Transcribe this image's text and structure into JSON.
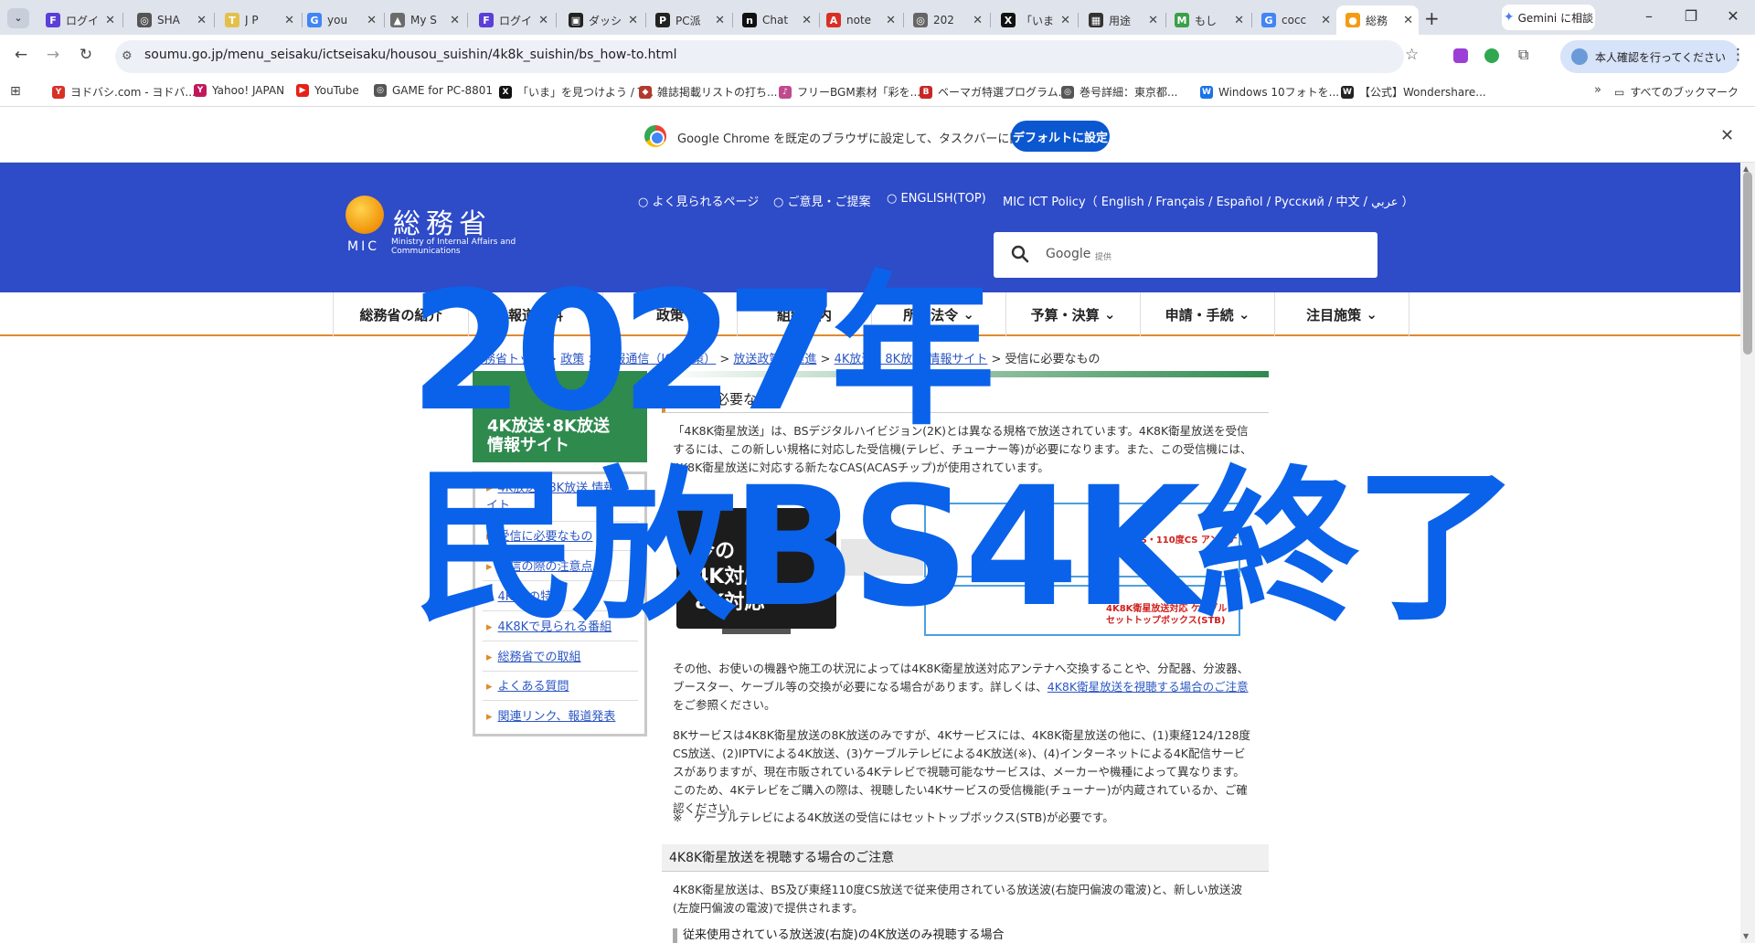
{
  "tabs": [
    {
      "label": "ログイ",
      "fav": "F",
      "color": "#5b3fd6"
    },
    {
      "label": "SHA",
      "fav": "◎",
      "color": "#555555"
    },
    {
      "label": "J P",
      "fav": "T",
      "color": "#e3c04a"
    },
    {
      "label": "you",
      "fav": "G",
      "color": "#4285f4"
    },
    {
      "label": "My S",
      "fav": "▲",
      "color": "#6b6b6b"
    },
    {
      "label": "ログイ",
      "fav": "F",
      "color": "#5b3fd6"
    },
    {
      "label": "ダッシ",
      "fav": "▣",
      "color": "#222222"
    },
    {
      "label": "PC派",
      "fav": "P",
      "color": "#222222"
    },
    {
      "label": "Chat",
      "fav": "n",
      "color": "#111111"
    },
    {
      "label": "note",
      "fav": "A",
      "color": "#d93025"
    },
    {
      "label": "202",
      "fav": "◎",
      "color": "#666666"
    },
    {
      "label": "「いま",
      "fav": "X",
      "color": "#111111"
    },
    {
      "label": "用途",
      "fav": "▦",
      "color": "#333333"
    },
    {
      "label": "もし",
      "fav": "M",
      "color": "#3aa04a"
    },
    {
      "label": "cocc",
      "fav": "G",
      "color": "#4285f4"
    },
    {
      "label": "総務",
      "fav": "●",
      "color": "#f39c12"
    }
  ],
  "gemini_label": "Gemini に相談",
  "url": "soumu.go.jp/menu_seisaku/ictseisaku/housou_suishin/4k8k_suishin/bs_how-to.html",
  "profile_label": "本人確認を行ってください",
  "bookmarks": [
    {
      "label": "ヨドバシ.com - ヨドバ...",
      "color": "#d93025",
      "fav": "Y"
    },
    {
      "label": "Yahoo! JAPAN",
      "color": "#c2185b",
      "fav": "Y"
    },
    {
      "label": "YouTube",
      "color": "#e62117",
      "fav": "▶"
    },
    {
      "label": "GAME for PC-8801",
      "color": "#555555",
      "fav": "◎"
    },
    {
      "label": "「いま」を見つけよう / T...",
      "color": "#111111",
      "fav": "X"
    },
    {
      "label": "雑誌掲載リストの打ち...",
      "color": "#b23a2c",
      "fav": "◆"
    },
    {
      "label": "フリーBGM素材「彩を...",
      "color": "#c04a8e",
      "fav": "♪"
    },
    {
      "label": "ベーマガ特選プログラム...",
      "color": "#c62828",
      "fav": "B"
    },
    {
      "label": "巻号詳細：東京都...",
      "color": "#555555",
      "fav": "◎"
    },
    {
      "label": "Windows 10フォトを...",
      "color": "#1a73e8",
      "fav": "W"
    },
    {
      "label": "【公式】Wondershare...",
      "color": "#222222",
      "fav": "W"
    }
  ],
  "all_bookmarks_label": "すべてのブックマーク",
  "infobar": {
    "text": "Google Chrome を既定のブラウザに設定して、タスクバーに固定する",
    "button": "デフォルトに設定"
  },
  "site": {
    "logo_kanji": "総務省",
    "logo_abbr": "MIC",
    "logo_english": "Ministry of Internal Affairs and Communications",
    "header_links": [
      "○ よく見られるページ",
      "○ ご意見・ご提案",
      "○ ENGLISH(TOP)",
      "MIC ICT Policy（ English /  Français /  Español /  Русский /  中文 /  عربي ）"
    ],
    "search_brand": "Google",
    "search_provider": "提供",
    "gnav": [
      "総務省の紹介",
      "報道資料",
      "政策",
      "組織案内",
      "所管法令",
      "予算・決算",
      "申請・手続",
      "注目施策"
    ]
  },
  "breadcrumb": [
    "総務省トップ",
    "政策",
    "情報通信（ICT政策）",
    "放送政策の推進",
    "4K放送・8K放送 情報サイト",
    "受信に必要なもの"
  ],
  "sidebar": {
    "title": "4K放送･8K放送\n情報サイト",
    "items": [
      "4K放送・8K放送 情報サイト",
      "受信に必要なもの",
      "受信の際の注意点",
      "4K8Kの特徴",
      "4K8Kで見られる番組",
      "総務省での取組",
      "よくある質問",
      "関連リンク、報道発表"
    ]
  },
  "content": {
    "heading": "受信に必要なもの",
    "p1": "「4K8K衛星放送」は、BSデジタルハイビジョン(2K)とは異なる規格で放送されています。4K8K衛星放送を受信するには、この新しい規格に対応した受信機(テレビ、チューナー等)が必要になります。また、この受信機には、4K8K衛星放送に対応する新たなCAS(ACASチップ)が使用されています。",
    "figure_tv_text": "今の\n4K対応\n8K対応",
    "figure_label1": "BS・110度CS アンテナ",
    "figure_label2": "4K8K衛星放送対応 ケーブルセットトップボックス(STB)",
    "p2_before": "その他、お使いの機器や施工の状況によっては4K8K衛星放送対応アンテナへ交換することや、分配器、分波器、ブースター、ケーブル等の交換が必要になる場合があります。詳しくは、",
    "p2_link": "4K8K衛星放送を視聴する場合のご注意",
    "p2_after": "をご参照ください。",
    "p3": "8Kサービスは4K8K衛星放送の8K放送のみですが、4Kサービスには、4K8K衛星放送の他に、(1)東経124/128度CS放送、(2)IPTVによる4K放送、(3)ケーブルテレビによる4K放送(※)、(4)インターネットによる4K配信サービスがありますが、現在市販されている4Kテレビで視聴可能なサービスは、メーカーや機種によって異なります。このため、4Kテレビをご購入の際は、視聴したい4Kサービスの受信機能(チューナー)が内蔵されているか、ご確認ください。",
    "note": "※　ケーブルテレビによる4K放送の受信にはセットトップボックス(STB)が必要です。",
    "sub_heading": "4K8K衛星放送を視聴する場合のご注意",
    "p4": "4K8K衛星放送は、BS及び東経110度CS放送で従来使用されている放送波(右旋円偏波の電波)と、新しい放送波(左旋円偏波の電波)で提供されます。",
    "sub_sub": "従来使用されている放送波(右旋)の4K放送のみ視聴する場合"
  },
  "overlay": {
    "line1": "2027年",
    "line2": "民放BS4K終了",
    "color": "#0a62ea"
  }
}
